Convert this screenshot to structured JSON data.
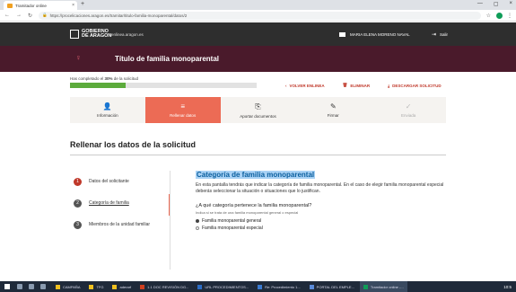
{
  "browser": {
    "tab_title": "Tramitador online",
    "tab_close": "×",
    "new_tab": "+",
    "url": "https://procelicaciones.aragon.es/tramitar/titulo-familia-monoparental/datos/2",
    "window_controls": [
      "—",
      "▢",
      "×"
    ]
  },
  "header": {
    "logo_line1": "GOBIERNO",
    "logo_line2": "DE ARAGON",
    "portal": "enlinea.aragon.es",
    "user": "MARIA ELENA MORENO NAVAL",
    "logout": "Salir"
  },
  "page": {
    "title": "Título de familia monoparental"
  },
  "progress": {
    "label_prefix": "Has completado el ",
    "percent_text": "30%",
    "label_suffix": " de la solicitud",
    "percent": 30
  },
  "actions": {
    "back": "VOLVER ENLINEA",
    "delete": "ELIMINAR",
    "download": "DESCARGAR SOLICITUD"
  },
  "steps": [
    {
      "label": "Información",
      "state": "done"
    },
    {
      "label": "Rellenar datos",
      "state": "active"
    },
    {
      "label": "Aportar documentos",
      "state": "pending"
    },
    {
      "label": "Firmar",
      "state": "pending"
    },
    {
      "label": "Enviada",
      "state": "disabled"
    }
  ],
  "section": {
    "title": "Rellenar los datos de la solicitud"
  },
  "sidenav": [
    {
      "num": "1",
      "label": "Datos del solicitante"
    },
    {
      "num": "2",
      "label": "Categoría de familia"
    },
    {
      "num": "3",
      "label": "Miembros de la unidad familiar"
    }
  ],
  "content": {
    "title": "Categoría de familia monoparental",
    "description": "En esta pantalla tendrás que indicar la categoría de familia monoparental. En el caso de elegir familia monoparental especial deberás seleccionar la situación o situaciones que lo justifican.",
    "question": "¿A qué categoría pertenece la familia monoparental?",
    "hint": "Indica si se trata de una familia monoparental general o especial",
    "options": [
      {
        "label": "Familia monoparental general",
        "checked": true
      },
      {
        "label": "Familia monoparental especial",
        "checked": false
      }
    ]
  },
  "taskbar": {
    "apps": [
      "CAMPAÑA",
      "TFG",
      "aderarf",
      "1.1 DOC REVISIÓN DG...",
      "URL PROCEDIMIENTOS...",
      "Re: Procedimiento 1...",
      "PORTAL DEL EMPLE...",
      "Tramitador online -..."
    ],
    "active_app": "Tramitador online -...",
    "tray": "10:5"
  }
}
